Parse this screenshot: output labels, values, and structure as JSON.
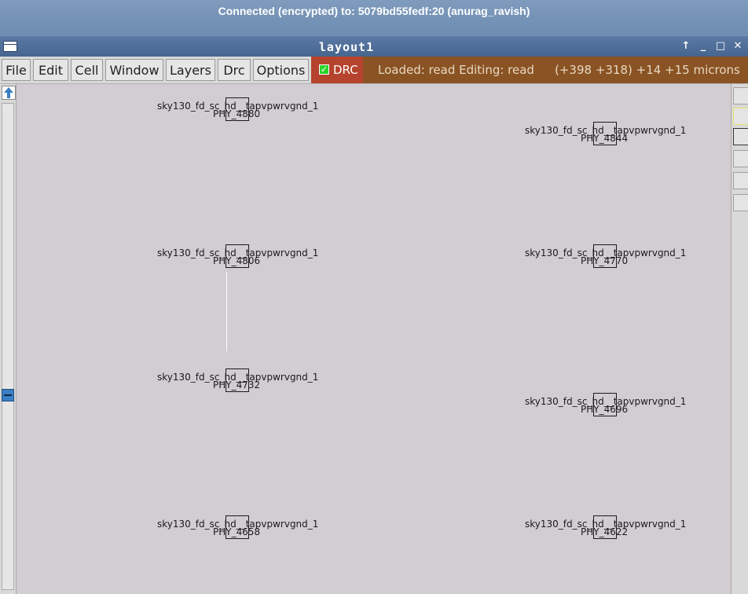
{
  "vnc": {
    "title": "Connected (encrypted) to: 5079bd55fedf:20 (anurag_ravish)"
  },
  "window": {
    "title": "layout1",
    "controls": {
      "up": "↑",
      "minimize": "_",
      "maximize": "□",
      "close": "✕"
    }
  },
  "menu": {
    "items": [
      "File",
      "Edit",
      "Cell",
      "Window",
      "Layers",
      "Drc",
      "Options"
    ]
  },
  "drc": {
    "label": "DRC",
    "checked": true
  },
  "status": {
    "left": "Loaded: read  Editing: read",
    "coords": "(+398 +318) +14 +15 microns"
  },
  "cells": [
    {
      "name": "sky130_fd_sc_hd__tapvpwrvgnd_1",
      "id": "PHY_4880"
    },
    {
      "name": "sky130_fd_sc_hd__tapvpwrvgnd_1",
      "id": "PHY_4844"
    },
    {
      "name": "sky130_fd_sc_hd__tapvpwrvgnd_1",
      "id": "PHY_4806"
    },
    {
      "name": "sky130_fd_sc_hd__tapvpwrvgnd_1",
      "id": "PHY_4770"
    },
    {
      "name": "sky130_fd_sc_hd__tapvpwrvgnd_1",
      "id": "PHY_4732"
    },
    {
      "name": "sky130_fd_sc_hd__tapvpwrvgnd_1",
      "id": "PHY_4696"
    },
    {
      "name": "sky130_fd_sc_hd__tapvpwrvgnd_1",
      "id": "PHY_4658"
    },
    {
      "name": "sky130_fd_sc_hd__tapvpwrvgnd_1",
      "id": "PHY_4622"
    }
  ],
  "colors": {
    "canvas": "#d2cdd2",
    "drc_bg": "#b5432d",
    "status_bg": "#8a5324",
    "titlebar": "#4c6b96"
  },
  "icons": {
    "scroll_up": "arrow-up-icon",
    "scroll_thumb": "minus-icon",
    "window_menu": "window-menu-icon"
  }
}
